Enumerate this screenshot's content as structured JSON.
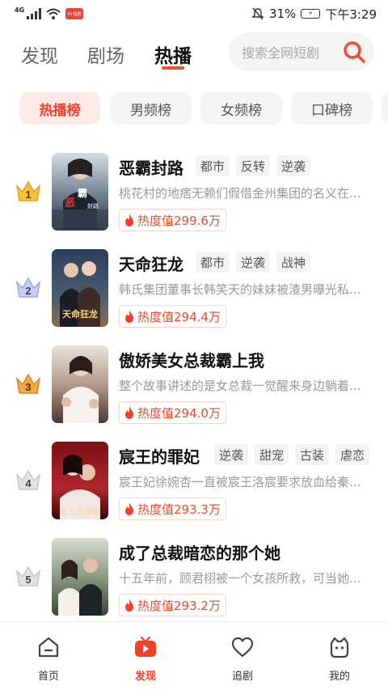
{
  "status_bar": {
    "network": "4G",
    "app_badge_text": "Hi 短剧",
    "battery": "31%",
    "time": "下午3:29"
  },
  "header": {
    "tabs": [
      {
        "label": "发现",
        "active": false
      },
      {
        "label": "剧场",
        "active": false
      },
      {
        "label": "热播",
        "active": true
      }
    ],
    "search_placeholder": "搜索全网短剧",
    "accent_color": "#f24b2d"
  },
  "chips": [
    {
      "label": "热播榜",
      "active": true
    },
    {
      "label": "男频榜",
      "active": false
    },
    {
      "label": "女频榜",
      "active": false
    },
    {
      "label": "口碑榜",
      "active": false
    }
  ],
  "rankings": [
    {
      "rank": "1",
      "crown": "gold-crown",
      "title": "恶霸封路",
      "tags": [
        "都市",
        "反转",
        "逆袭"
      ],
      "description": "桃花村的地痞无赖们假借金州集团的名义在...",
      "heat": "热度值299.6万",
      "poster_text": [
        "恶",
        "霸",
        "封路"
      ]
    },
    {
      "rank": "2",
      "crown": "silver-crown",
      "title": "天命狂龙",
      "tags": [
        "都市",
        "逆袭",
        "战神"
      ],
      "description": "韩氏集团董事长韩笑天的妹妹被渣男曝光私...",
      "heat": "热度值294.4万",
      "poster_text": [
        "天命狂龙"
      ]
    },
    {
      "rank": "3",
      "crown": "bronze-crown",
      "title": "傲娇美女总裁霸上我",
      "tags": [],
      "description": "整个故事讲述的是女总裁一觉醒来身边躺着...",
      "heat": "热度值294.0万",
      "poster_text": []
    },
    {
      "rank": "4",
      "crown": "grey-crown",
      "title": "宸王的罪妃",
      "tags": [
        "逆袭",
        "甜宠",
        "古装",
        "虐恋"
      ],
      "description": "宸王妃徐婉杏一直被宸王洛宸要求放血给秦...",
      "heat": "热度值293.3万",
      "poster_text": [
        "宸王的罪妃"
      ]
    },
    {
      "rank": "5",
      "crown": "grey-crown",
      "title": "成了总裁暗恋的那个她",
      "tags": [],
      "description": "十五年前，顾君栩被一个女孩所救，可当她...",
      "heat": "热度值293.2万",
      "poster_text": []
    }
  ],
  "bottom_nav": [
    {
      "label": "首页",
      "icon": "home-icon",
      "active": false
    },
    {
      "label": "发现",
      "icon": "tv-play-icon",
      "active": true
    },
    {
      "label": "追剧",
      "icon": "heart-icon",
      "active": false
    },
    {
      "label": "我的",
      "icon": "profile-face-icon",
      "active": false
    }
  ]
}
